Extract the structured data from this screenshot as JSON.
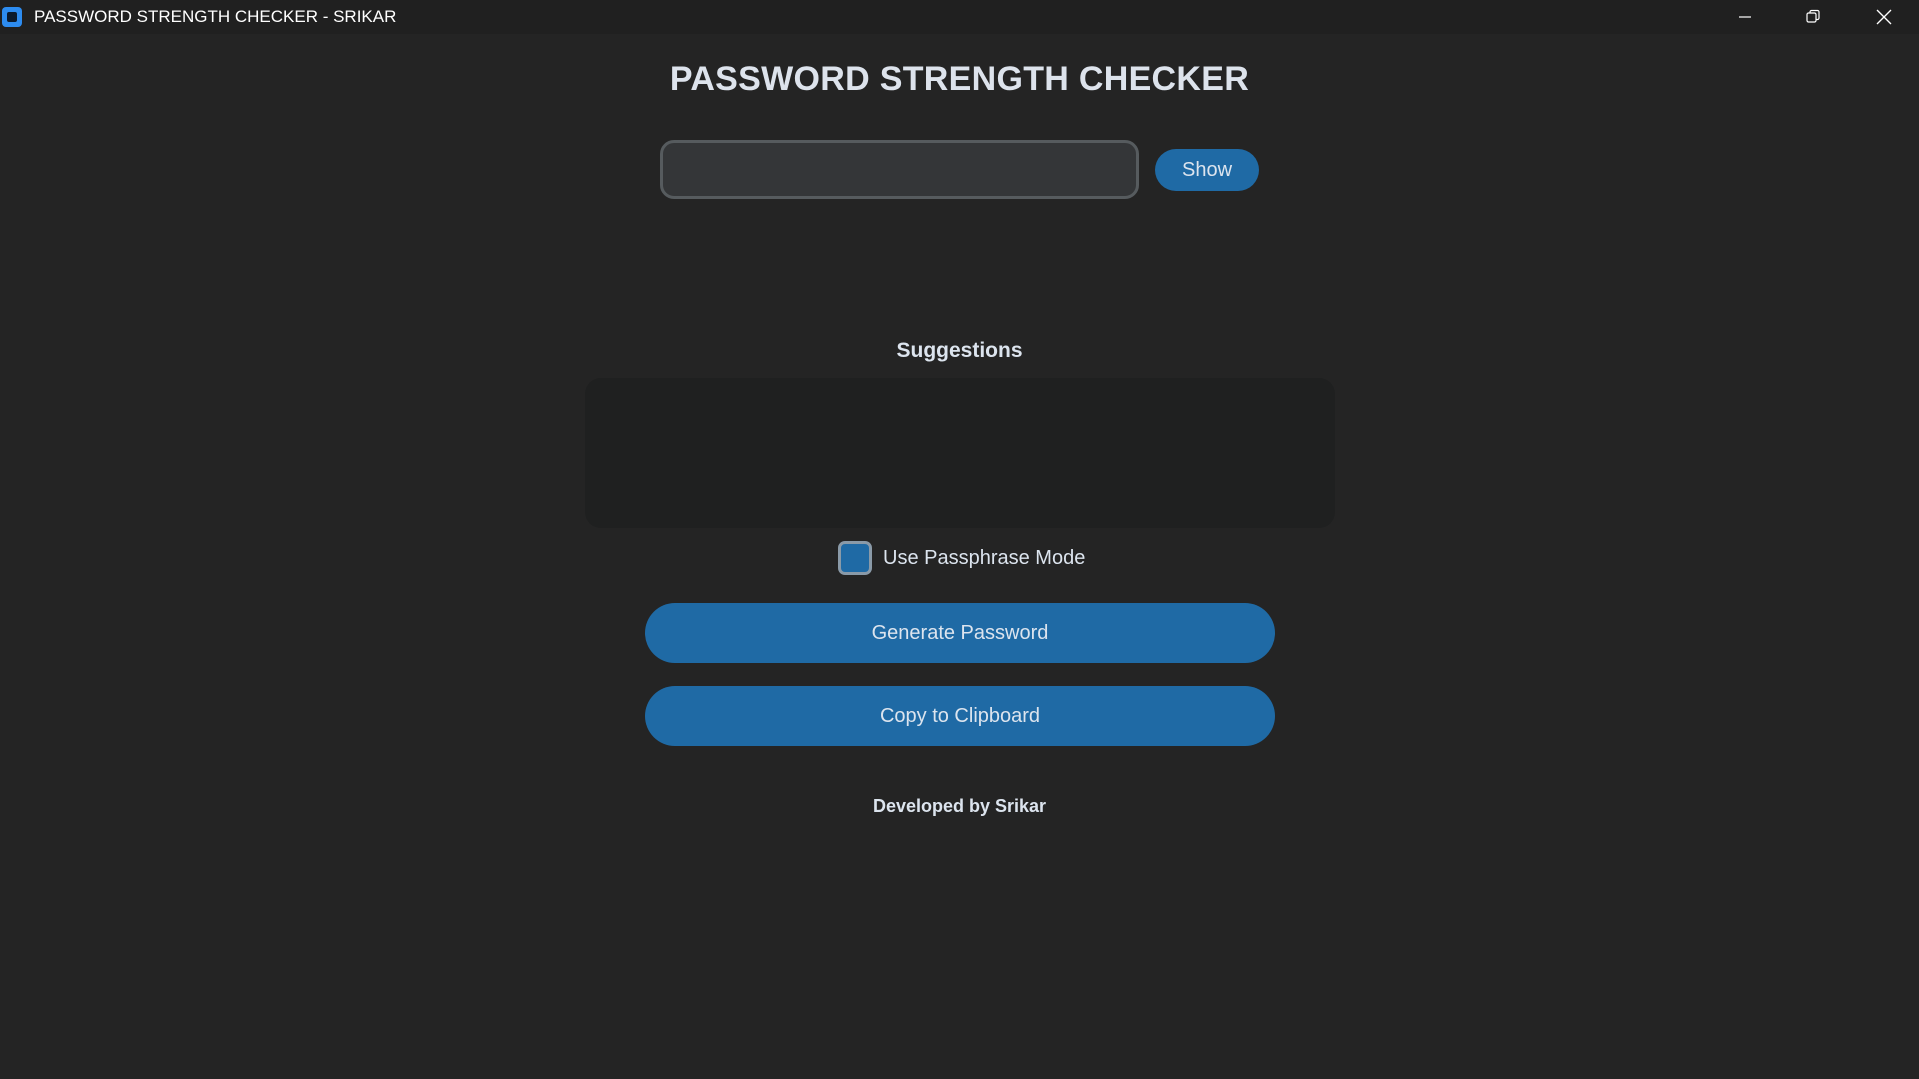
{
  "window": {
    "title": "PASSWORD STRENGTH CHECKER - SRIKAR",
    "controls": [
      "minimize-icon",
      "restore-icon",
      "close-icon"
    ]
  },
  "header": {
    "title": "PASSWORD STRENGTH CHECKER"
  },
  "password": {
    "value": "",
    "placeholder": "",
    "show_label": "Show"
  },
  "suggestions": {
    "label": "Suggestions",
    "content": ""
  },
  "passphrase": {
    "label": "Use Passphrase Mode",
    "checked": false
  },
  "actions": {
    "generate_label": "Generate Password",
    "copy_label": "Copy to Clipboard"
  },
  "footer": {
    "text": "Developed by Srikar"
  },
  "colors": {
    "background": "#242424",
    "titlebar": "#202020",
    "accent": "#1f6aa5",
    "input_bg": "#343638",
    "text": "#dce4ee"
  }
}
